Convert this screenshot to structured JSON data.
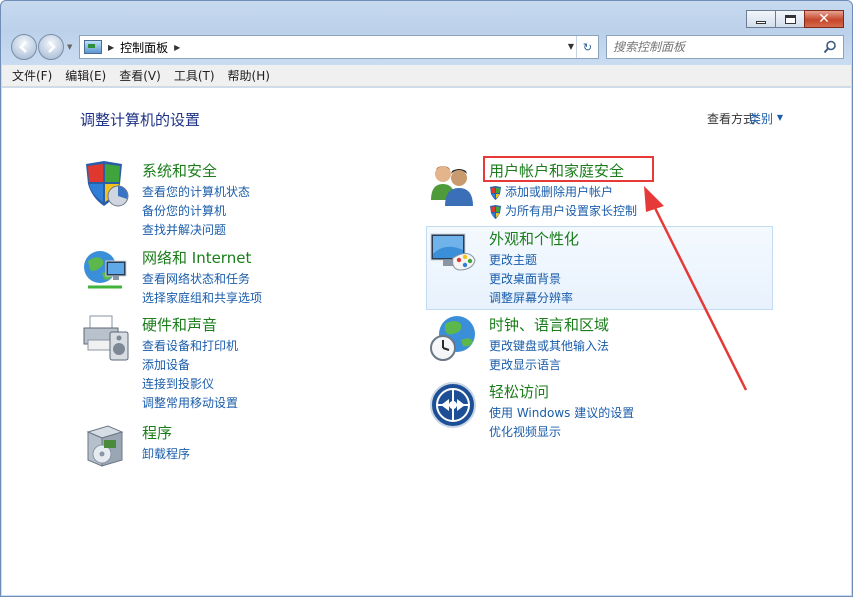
{
  "window": {
    "address": {
      "crumb": "控制面板"
    },
    "search": {
      "placeholder": "搜索控制面板"
    }
  },
  "menu": [
    "文件(F)",
    "编辑(E)",
    "查看(V)",
    "工具(T)",
    "帮助(H)"
  ],
  "content": {
    "title": "调整计算机的设置",
    "view_by_label": "查看方式:",
    "view_by_value": "类别"
  },
  "categories": {
    "system": {
      "title": "系统和安全",
      "links": [
        "查看您的计算机状态",
        "备份您的计算机",
        "查找并解决问题"
      ]
    },
    "network": {
      "title": "网络和 Internet",
      "links": [
        "查看网络状态和任务",
        "选择家庭组和共享选项"
      ]
    },
    "hardware": {
      "title": "硬件和声音",
      "links": [
        "查看设备和打印机",
        "添加设备",
        "连接到投影仪",
        "调整常用移动设置"
      ]
    },
    "programs": {
      "title": "程序",
      "links": [
        "卸载程序"
      ]
    },
    "users": {
      "title": "用户帐户和家庭安全",
      "links": [
        "添加或删除用户帐户",
        "为所有用户设置家长控制"
      ]
    },
    "appearance": {
      "title": "外观和个性化",
      "links": [
        "更改主题",
        "更改桌面背景",
        "调整屏幕分辨率"
      ]
    },
    "clock": {
      "title": "时钟、语言和区域",
      "links": [
        "更改键盘或其他输入法",
        "更改显示语言"
      ]
    },
    "ease": {
      "title": "轻松访问",
      "links": [
        "使用 Windows 建议的设置",
        "优化视频显示"
      ]
    }
  },
  "colors": {
    "category_title": "#1a7d1a",
    "link": "#1a5dab",
    "annotation": "#e53a38"
  },
  "icons": {
    "system": "shield-pie-icon",
    "network": "globe-monitor-icon",
    "hardware": "printer-speaker-icon",
    "programs": "software-box-icon",
    "users": "two-users-icon",
    "appearance": "monitor-palette-icon",
    "clock": "globe-clock-icon",
    "ease": "accessibility-icon"
  }
}
